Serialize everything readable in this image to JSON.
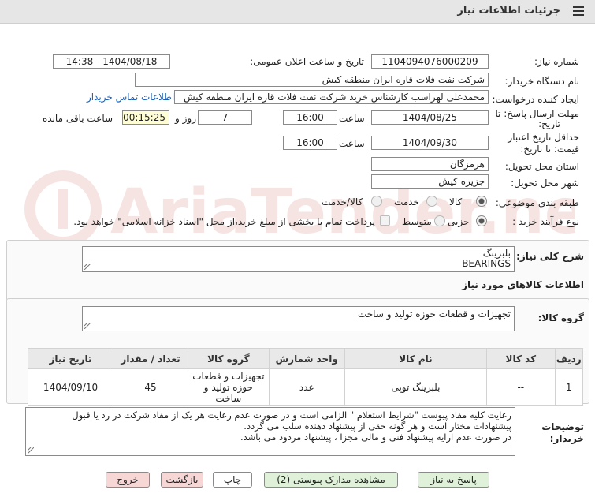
{
  "header": {
    "title": "جزئیات اطلاعات نیاز"
  },
  "form": {
    "need_number_label": "شماره نیاز:",
    "need_number": "1104094076000209",
    "announce_label": "تاریخ و ساعت اعلان عمومی:",
    "announce_value": "1404/08/18 - 14:38",
    "buyer_org_label": "نام دستگاه خریدار:",
    "buyer_org": "شرکت نفت فلات قاره ایران منطقه کیش",
    "creator_label": "ایجاد کننده درخواست:",
    "creator": "محمدعلی لهراسب کارشناس خرید شرکت نفت فلات قاره ایران منطقه کیش",
    "contact_link": "اطلاعات تماس خریدار",
    "deadline_label_1": "مهلت ارسال پاسخ: تا",
    "deadline_label_2": "تاریخ:",
    "deadline_date": "1404/08/25",
    "time_label": "ساعت",
    "deadline_time": "16:00",
    "days_value": "7",
    "days_label": "روز و",
    "remaining_time": "00:15:25",
    "remaining_label": "ساعت باقی مانده",
    "validity_label_1": "حداقل تاریخ اعتبار",
    "validity_label_2": "قیمت: تا تاریخ:",
    "validity_date": "1404/09/30",
    "validity_time": "16:00",
    "province_label": "استان محل تحویل:",
    "province": "هرمزگان",
    "city_label": "شهر محل تحویل:",
    "city": "جزیره کیش",
    "category_label": "طبقه بندی موضوعی:",
    "category_options": [
      "کالا",
      "خدمت",
      "کالا/خدمت"
    ],
    "category_selected": "کالا",
    "process_label": "نوع فرآیند خرید :",
    "process_options": [
      "جزیی",
      "متوسط"
    ],
    "process_selected": "جزیی",
    "payment_note": "پرداخت تمام یا بخشی از مبلغ خرید،از محل \"اسناد خزانه اسلامی\" خواهد بود."
  },
  "need_desc": {
    "label": "شرح کلی نیاز:",
    "line1": "بلبرینگ",
    "line2": "BEARINGS"
  },
  "goods": {
    "section_title": "اطلاعات کالاهای مورد نیاز",
    "group_label": "گروه کالا:",
    "group_value": "تجهیزات و قطعات حوزه تولید و ساخت",
    "columns": [
      "ردیف",
      "کد کالا",
      "نام کالا",
      "واحد شمارش",
      "گروه کالا",
      "تعداد / مقدار",
      "تاریخ نیاز"
    ],
    "rows": [
      {
        "row": "1",
        "code": "--",
        "name": "بلبرینگ توپی",
        "unit": "عدد",
        "group": "تجهیزات و قطعات حوزه تولید و ساخت",
        "qty": "45",
        "date": "1404/09/10"
      }
    ]
  },
  "buyer_notes": {
    "label_1": "توضیحات",
    "label_2": "خریدار:",
    "line1": "رعایت کلیه مفاد  پیوست \"شرایط استعلام \" الزامی است و در صورت عدم رعایت هر یک از مفاد شرکت در رد یا قبول",
    "line2": "پیشنهادات مختار است  و هر گونه حقی از پیشنهاد دهنده سلب می گردد.",
    "line3": "در صورت عدم ارایه پیشنهاد فنی و مالی مجزا ، پیشنهاد مردود می باشد."
  },
  "buttons": {
    "respond": "پاسخ به نیاز",
    "attachments": "مشاهده مدارک پیوستی (2)",
    "print": "چاپ",
    "back": "بازگشت",
    "exit": "خروج"
  },
  "watermark": {
    "text": "AriaTender.neT"
  },
  "colors": {
    "link": "#1a5fb4",
    "yellow_field": "#fffdd4",
    "pink_button": "#f7d6d6",
    "green_button": "#dff2d9",
    "header_bg": "#e6e6e6"
  }
}
